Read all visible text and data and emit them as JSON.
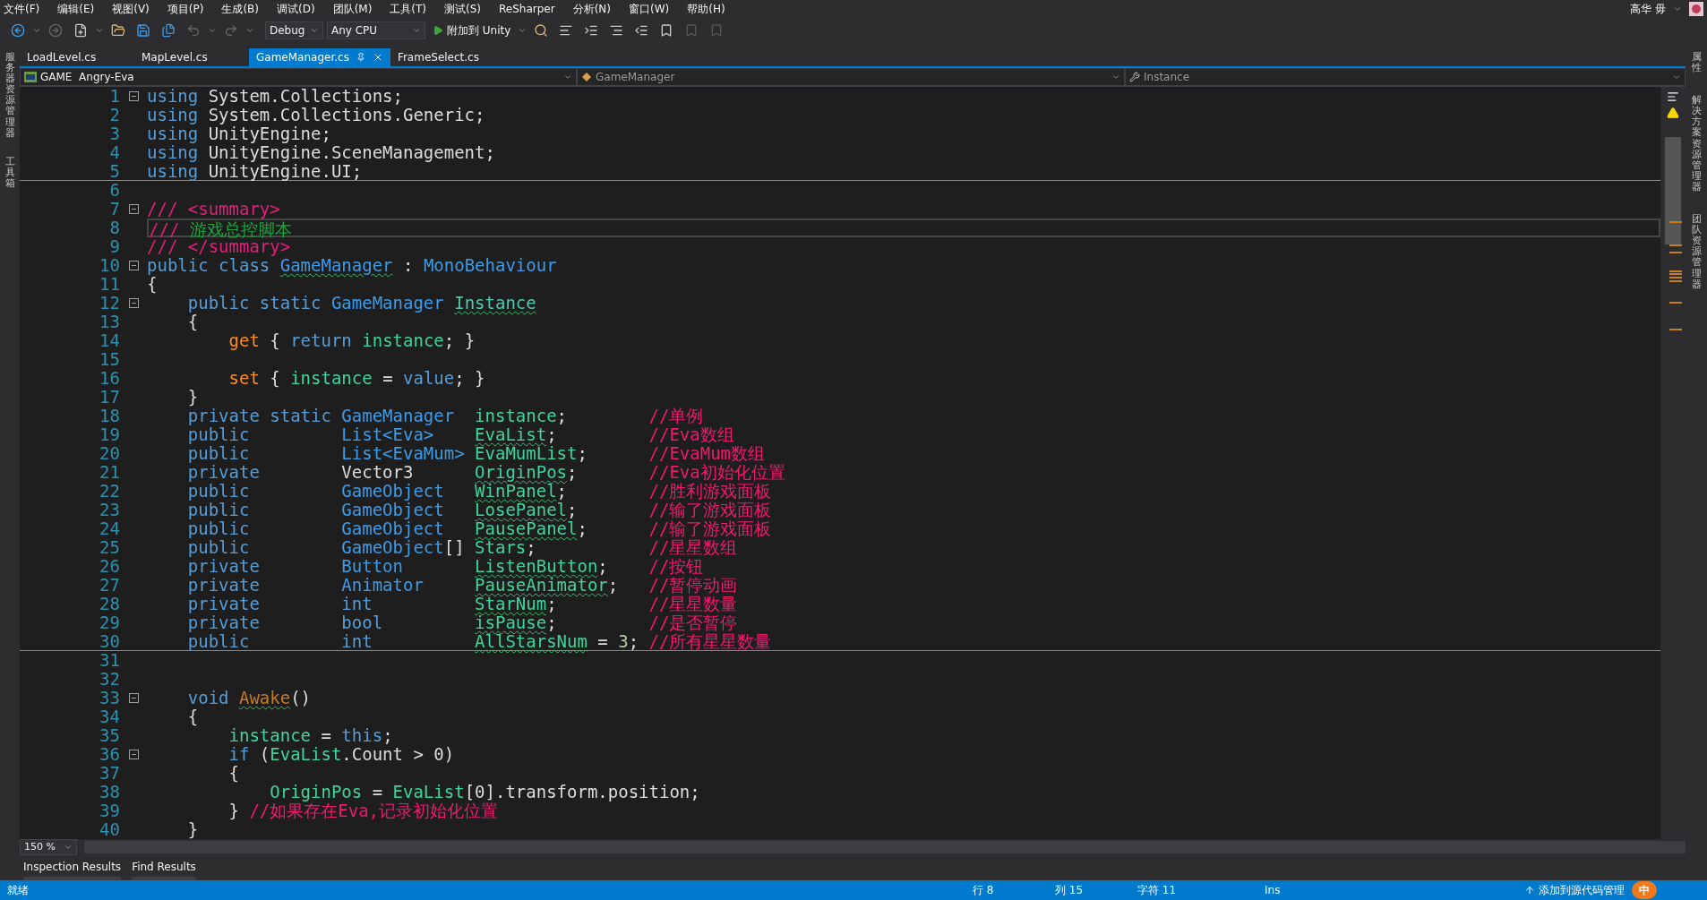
{
  "menu": [
    "文件(F)",
    "编辑(E)",
    "视图(V)",
    "项目(P)",
    "生成(B)",
    "调试(D)",
    "团队(M)",
    "工具(T)",
    "测试(S)",
    "ReSharper",
    "分析(N)",
    "窗口(W)",
    "帮助(H)"
  ],
  "user": "高华 毋",
  "toolbar": {
    "configuration": "Debug",
    "platform": "Any CPU",
    "run": "附加到 Unity"
  },
  "tabs": [
    {
      "label": "LoadLevel.cs",
      "selected": false
    },
    {
      "label": "MapLevel.cs",
      "selected": false
    },
    {
      "label": "GameManager.cs",
      "selected": true
    },
    {
      "label": "FrameSelect.cs",
      "selected": false
    }
  ],
  "left_sidebar": [
    "服务器资源管理器",
    "工具箱"
  ],
  "right_sidebar": [
    "属性",
    "解决方案资源管理器",
    "团队资源管理器"
  ],
  "nav_bar": {
    "project": "GAME  Angry-Eva",
    "type": "GameManager",
    "member": "Instance"
  },
  "lines": [
    {
      "number": "1",
      "fold": true,
      "tokens": [
        {
          "kind": "kw",
          "text": "using"
        },
        {
          "kind": "plain",
          "text": " System.Collections;"
        }
      ]
    },
    {
      "number": "2",
      "tokens": [
        {
          "kind": "kw",
          "text": "using"
        },
        {
          "kind": "plain",
          "text": " System.Collections.Generic;"
        }
      ]
    },
    {
      "number": "3",
      "tokens": [
        {
          "kind": "kw",
          "text": "using"
        },
        {
          "kind": "plain",
          "text": " UnityEngine;"
        }
      ]
    },
    {
      "number": "4",
      "tokens": [
        {
          "kind": "kw",
          "text": "using"
        },
        {
          "kind": "plain",
          "text": " UnityEngine.SceneManagement;"
        }
      ]
    },
    {
      "number": "5",
      "rule_below": true,
      "tokens": [
        {
          "kind": "kw",
          "text": "using"
        },
        {
          "kind": "plain",
          "text": " UnityEngine.UI;"
        }
      ]
    },
    {
      "number": "6"
    },
    {
      "number": "7",
      "fold": true,
      "tokens": [
        {
          "kind": "doc",
          "text": "/// <summary>"
        }
      ]
    },
    {
      "number": "8",
      "current": true,
      "tokens": [
        {
          "kind": "doc",
          "text": "/// "
        },
        {
          "kind": "doctext",
          "text": "游戏总控脚本"
        }
      ]
    },
    {
      "number": "9",
      "tokens": [
        {
          "kind": "doc",
          "text": "/// </summary>"
        }
      ]
    },
    {
      "number": "10",
      "fold": true,
      "tokens": [
        {
          "kind": "kw",
          "text": "public class "
        },
        {
          "kind": "type",
          "text": "GameManager",
          "squiggle": true
        },
        {
          "kind": "plain",
          "text": " : "
        },
        {
          "kind": "type",
          "text": "MonoBehaviour"
        }
      ]
    },
    {
      "number": "11",
      "tokens": [
        {
          "kind": "plain",
          "text": "{"
        }
      ]
    },
    {
      "number": "12",
      "fold": true,
      "tokens": [
        {
          "kind": "kw",
          "text": "    public static "
        },
        {
          "kind": "type",
          "text": "GameManager "
        },
        {
          "kind": "prop",
          "text": "Instance",
          "squiggle": true
        }
      ]
    },
    {
      "number": "13",
      "tokens": [
        {
          "kind": "plain",
          "text": "    {"
        }
      ]
    },
    {
      "number": "14",
      "tokens": [
        {
          "kind": "accessor",
          "text": "        get"
        },
        {
          "kind": "plain",
          "text": " { "
        },
        {
          "kind": "kw",
          "text": "return "
        },
        {
          "kind": "field",
          "text": "instance"
        },
        {
          "kind": "plain",
          "text": "; }"
        }
      ]
    },
    {
      "number": "15"
    },
    {
      "number": "16",
      "tokens": [
        {
          "kind": "accessor",
          "text": "        set"
        },
        {
          "kind": "plain",
          "text": " { "
        },
        {
          "kind": "field",
          "text": "instance"
        },
        {
          "kind": "plain",
          "text": " = "
        },
        {
          "kind": "kw",
          "text": "value"
        },
        {
          "kind": "plain",
          "text": "; }"
        }
      ]
    },
    {
      "number": "17",
      "tokens": [
        {
          "kind": "plain",
          "text": "    }"
        }
      ]
    },
    {
      "number": "18",
      "tokens": [
        {
          "kind": "kw",
          "text": "    private static "
        },
        {
          "kind": "type",
          "text": "GameManager  "
        },
        {
          "kind": "field",
          "text": "instance"
        },
        {
          "kind": "plain",
          "text": ";        "
        },
        {
          "kind": "comment",
          "text": "//单例"
        }
      ]
    },
    {
      "number": "19",
      "tokens": [
        {
          "kind": "kw",
          "text": "    public         "
        },
        {
          "kind": "type",
          "text": "List<Eva>    "
        },
        {
          "kind": "field",
          "text": "EvaList",
          "squiggle": true
        },
        {
          "kind": "plain",
          "text": ";         "
        },
        {
          "kind": "comment",
          "text": "//Eva数组"
        }
      ]
    },
    {
      "number": "20",
      "tokens": [
        {
          "kind": "kw",
          "text": "    public         "
        },
        {
          "kind": "type",
          "text": "List<EvaMum> "
        },
        {
          "kind": "field",
          "text": "EvaMumList"
        },
        {
          "kind": "plain",
          "text": ";      "
        },
        {
          "kind": "comment",
          "text": "//EvaMum数组"
        }
      ]
    },
    {
      "number": "21",
      "tokens": [
        {
          "kind": "kw",
          "text": "    private        "
        },
        {
          "kind": "plain",
          "text": "Vector3      "
        },
        {
          "kind": "field",
          "text": "OriginPos",
          "squiggle": true
        },
        {
          "kind": "plain",
          "text": ";       "
        },
        {
          "kind": "comment",
          "text": "//Eva初始化位置"
        }
      ]
    },
    {
      "number": "22",
      "tokens": [
        {
          "kind": "kw",
          "text": "    public         "
        },
        {
          "kind": "type",
          "text": "GameObject   "
        },
        {
          "kind": "field",
          "text": "WinPanel",
          "squiggle": true
        },
        {
          "kind": "plain",
          "text": ";        "
        },
        {
          "kind": "comment",
          "text": "//胜利游戏面板"
        }
      ]
    },
    {
      "number": "23",
      "tokens": [
        {
          "kind": "kw",
          "text": "    public         "
        },
        {
          "kind": "type",
          "text": "GameObject   "
        },
        {
          "kind": "field",
          "text": "LosePanel",
          "squiggle": true
        },
        {
          "kind": "plain",
          "text": ";       "
        },
        {
          "kind": "comment",
          "text": "//输了游戏面板"
        }
      ]
    },
    {
      "number": "24",
      "tokens": [
        {
          "kind": "kw",
          "text": "    public         "
        },
        {
          "kind": "type",
          "text": "GameObject   "
        },
        {
          "kind": "field",
          "text": "PausePanel",
          "squiggle": true
        },
        {
          "kind": "plain",
          "text": ";      "
        },
        {
          "kind": "comment",
          "text": "//输了游戏面板"
        }
      ]
    },
    {
      "number": "25",
      "tokens": [
        {
          "kind": "kw",
          "text": "    public         "
        },
        {
          "kind": "type",
          "text": "GameObject"
        },
        {
          "kind": "plain",
          "text": "[] "
        },
        {
          "kind": "field",
          "text": "Stars"
        },
        {
          "kind": "plain",
          "text": ";           "
        },
        {
          "kind": "comment",
          "text": "//星星数组"
        }
      ]
    },
    {
      "number": "26",
      "tokens": [
        {
          "kind": "kw",
          "text": "    private        "
        },
        {
          "kind": "type",
          "text": "Button       "
        },
        {
          "kind": "field",
          "text": "ListenButton",
          "squiggle": true
        },
        {
          "kind": "plain",
          "text": ";    "
        },
        {
          "kind": "comment",
          "text": "//按钮"
        }
      ]
    },
    {
      "number": "27",
      "tokens": [
        {
          "kind": "kw",
          "text": "    private        "
        },
        {
          "kind": "type",
          "text": "Animator     "
        },
        {
          "kind": "field",
          "text": "PauseAnimator",
          "squiggle": true
        },
        {
          "kind": "plain",
          "text": ";   "
        },
        {
          "kind": "comment",
          "text": "//暂停动画"
        }
      ]
    },
    {
      "number": "28",
      "tokens": [
        {
          "kind": "kw",
          "text": "    private        "
        },
        {
          "kind": "kw",
          "text": "int          "
        },
        {
          "kind": "field",
          "text": "StarNum",
          "squiggle": true
        },
        {
          "kind": "plain",
          "text": ";         "
        },
        {
          "kind": "comment",
          "text": "//星星数量"
        }
      ]
    },
    {
      "number": "29",
      "tokens": [
        {
          "kind": "kw",
          "text": "    private        "
        },
        {
          "kind": "kw",
          "text": "bool         "
        },
        {
          "kind": "field",
          "text": "isPause",
          "squiggle": true
        },
        {
          "kind": "plain",
          "text": ";         "
        },
        {
          "kind": "comment",
          "text": "//是否暂停"
        }
      ]
    },
    {
      "number": "30",
      "rule_below": true,
      "tokens": [
        {
          "kind": "kw",
          "text": "    public         "
        },
        {
          "kind": "kw",
          "text": "int          "
        },
        {
          "kind": "field",
          "text": "AllStarsNum",
          "squiggle": true
        },
        {
          "kind": "plain",
          "text": " = "
        },
        {
          "kind": "number",
          "text": "3"
        },
        {
          "kind": "plain",
          "text": "; "
        },
        {
          "kind": "comment",
          "text": "//所有星星数量"
        }
      ]
    },
    {
      "number": "31"
    },
    {
      "number": "32"
    },
    {
      "number": "33",
      "fold": true,
      "tokens": [
        {
          "kind": "kw",
          "text": "    void "
        },
        {
          "kind": "method",
          "text": "Awake",
          "squiggle": true
        },
        {
          "kind": "plain",
          "text": "()"
        }
      ]
    },
    {
      "number": "34",
      "tokens": [
        {
          "kind": "plain",
          "text": "    {"
        }
      ]
    },
    {
      "number": "35",
      "tokens": [
        {
          "kind": "field",
          "text": "        instance"
        },
        {
          "kind": "plain",
          "text": " = "
        },
        {
          "kind": "kw",
          "text": "this"
        },
        {
          "kind": "plain",
          "text": ";"
        }
      ]
    },
    {
      "number": "36",
      "fold": true,
      "tokens": [
        {
          "kind": "kw",
          "text": "        if"
        },
        {
          "kind": "plain",
          "text": " ("
        },
        {
          "kind": "field",
          "text": "EvaList"
        },
        {
          "kind": "plain",
          "text": ".Count > 0)"
        }
      ]
    },
    {
      "number": "37",
      "tokens": [
        {
          "kind": "plain",
          "text": "        {"
        }
      ]
    },
    {
      "number": "38",
      "tokens": [
        {
          "kind": "field",
          "text": "            OriginPos"
        },
        {
          "kind": "plain",
          "text": " = "
        },
        {
          "kind": "field",
          "text": "EvaList"
        },
        {
          "kind": "plain",
          "text": "[0].transform.position;"
        }
      ]
    },
    {
      "number": "39",
      "tokens": [
        {
          "kind": "plain",
          "text": "        } "
        },
        {
          "kind": "comment",
          "text": "//如果存在Eva,记录初始化位置"
        }
      ]
    },
    {
      "number": "40",
      "tokens": [
        {
          "kind": "plain",
          "text": "    }"
        }
      ]
    }
  ],
  "zoom": "150 %",
  "bottom_tabs": [
    "Inspection Results",
    "Find Results"
  ],
  "status_bar": {
    "message": "就绪",
    "line": "行 8",
    "column": "列 15",
    "char": "字符 11",
    "mode": "Ins",
    "source_control": "添加到源代码管理",
    "ime": "中"
  }
}
